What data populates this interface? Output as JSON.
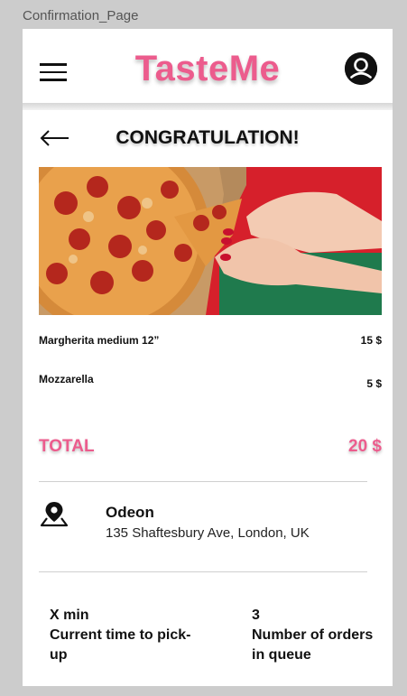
{
  "frame_label": "Confirmation_Page",
  "header": {
    "brand": "TasteMe",
    "menu_icon": "hamburger-menu-icon",
    "profile_icon": "user-avatar-icon"
  },
  "page": {
    "title": "CONGRATULATION!",
    "back_icon": "arrow-left-icon"
  },
  "order": {
    "items": [
      {
        "name": "Margherita medium 12”",
        "price": "15 $"
      },
      {
        "name": "Mozzarella",
        "price": "5 $"
      }
    ],
    "total_label": "TOTAL",
    "total_value": "20 $"
  },
  "location": {
    "icon": "map-pin-icon",
    "name": "Odeon",
    "address": "135 Shaftesbury Ave, London, UK"
  },
  "stats": {
    "pickup_value": "X min",
    "pickup_label": "Current time to pick-up",
    "queue_value": "3",
    "queue_label": "Number of orders in queue"
  },
  "colors": {
    "accent": "#ec5c8d",
    "background": "#cccccc",
    "surface": "#ffffff"
  }
}
